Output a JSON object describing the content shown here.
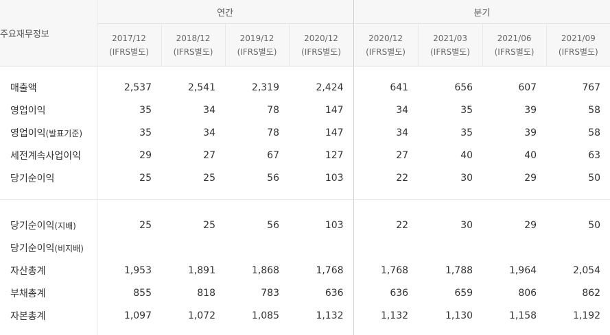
{
  "header": {
    "corner_label": "주요재무정보",
    "groups": [
      "연간",
      "분기"
    ]
  },
  "periods": [
    {
      "date": "2017/12",
      "type": "(IFRS별도)"
    },
    {
      "date": "2018/12",
      "type": "(IFRS별도)"
    },
    {
      "date": "2019/12",
      "type": "(IFRS별도)"
    },
    {
      "date": "2020/12",
      "type": "(IFRS별도)"
    },
    {
      "date": "2020/12",
      "type": "(IFRS별도)"
    },
    {
      "date": "2021/03",
      "type": "(IFRS별도)"
    },
    {
      "date": "2021/06",
      "type": "(IFRS별도)"
    },
    {
      "date": "2021/09",
      "type": "(IFRS별도)"
    }
  ],
  "rows": [
    {
      "label": "매출액",
      "values": [
        "2,537",
        "2,541",
        "2,319",
        "2,424",
        "641",
        "656",
        "607",
        "767"
      ]
    },
    {
      "label": "영업이익",
      "values": [
        "35",
        "34",
        "78",
        "147",
        "34",
        "35",
        "39",
        "58"
      ]
    },
    {
      "label": "영업이익",
      "paren": "(발표기준)",
      "values": [
        "35",
        "34",
        "78",
        "147",
        "34",
        "35",
        "39",
        "58"
      ]
    },
    {
      "label": "세전계속사업이익",
      "values": [
        "29",
        "27",
        "67",
        "127",
        "27",
        "40",
        "40",
        "63"
      ]
    },
    {
      "label": "당기순이익",
      "values": [
        "25",
        "25",
        "56",
        "103",
        "22",
        "30",
        "29",
        "50"
      ]
    },
    {
      "label": "당기순이익",
      "paren": "(지배)",
      "values": [
        "25",
        "25",
        "56",
        "103",
        "22",
        "30",
        "29",
        "50"
      ]
    },
    {
      "label": "당기순이익",
      "paren": "(비지배)",
      "values": [
        "",
        "",
        "",
        "",
        "",
        "",
        "",
        ""
      ]
    },
    {
      "label": "자산총계",
      "values": [
        "1,953",
        "1,891",
        "1,868",
        "1,768",
        "1,768",
        "1,788",
        "1,964",
        "2,054"
      ]
    },
    {
      "label": "부채총계",
      "values": [
        "855",
        "818",
        "783",
        "636",
        "636",
        "659",
        "806",
        "862"
      ]
    },
    {
      "label": "자본총계",
      "values": [
        "1,097",
        "1,072",
        "1,085",
        "1,132",
        "1,132",
        "1,130",
        "1,158",
        "1,192"
      ]
    }
  ]
}
